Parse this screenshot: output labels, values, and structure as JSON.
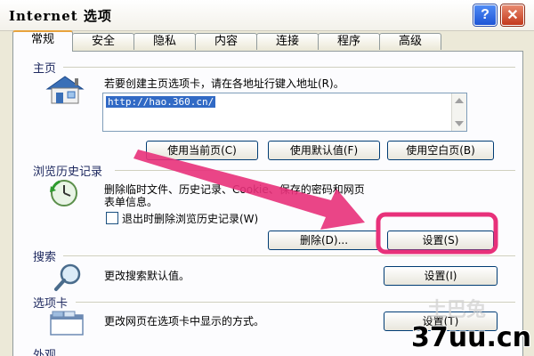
{
  "window": {
    "title": "Internet 选项",
    "help_glyph": "?",
    "close_glyph": "✕"
  },
  "tabs": [
    {
      "label": "常规",
      "active": true
    },
    {
      "label": "安全",
      "active": false
    },
    {
      "label": "隐私",
      "active": false
    },
    {
      "label": "内容",
      "active": false
    },
    {
      "label": "连接",
      "active": false
    },
    {
      "label": "程序",
      "active": false
    },
    {
      "label": "高级",
      "active": false
    }
  ],
  "home": {
    "title": "主页",
    "description": "若要创建主页选项卡，请在各地址行键入地址(R)。",
    "url": "http://hao.360.cn/",
    "use_current": "使用当前页(C)",
    "use_default": "使用默认值(F)",
    "use_blank": "使用空白页(B)"
  },
  "history": {
    "title": "浏览历史记录",
    "description_line1": "删除临时文件、历史记录、Cookie、保存的密码和网页",
    "description_line2": "表单信息。",
    "checkbox_label": "退出时删除浏览历史记录(W)",
    "checkbox_checked": false,
    "delete_button": "删除(D)...",
    "settings_button": "设置(S)"
  },
  "search": {
    "title": "搜索",
    "description": "更改搜索默认值。",
    "settings_button": "设置(I)"
  },
  "tabs_section": {
    "title": "选项卡",
    "description": "更改网页在选项卡中显示的方式。",
    "settings_button": "设置(T)"
  },
  "appearance": {
    "title": "外观"
  },
  "overlay": {
    "watermark": "37uu.cn",
    "faint_watermark": "土巴兔",
    "arrow_color": "#e8317a",
    "highlight_color": "#e8317a"
  },
  "icons": {
    "home": "house-icon",
    "history": "clock-arrow-icon",
    "search": "magnifier-icon",
    "tabs": "tabbed-window-icon"
  }
}
